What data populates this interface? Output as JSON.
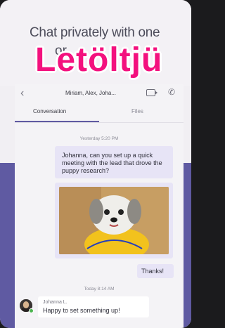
{
  "promo": {
    "line1": "Chat privately with one",
    "line2": "or",
    "overlay": "Letöltjü"
  },
  "header": {
    "title": "Miriam, Alex, Joha..."
  },
  "tabs": {
    "conversation": "Conversation",
    "files": "Files"
  },
  "messages": {
    "time1": "Yesterday 5:20 PM",
    "me_text": "Johanna, can you set up a quick meeting with the lead that drove the puppy research?",
    "photo_alt": "puppy photo",
    "thanks": "Thanks!",
    "time2": "Today 8:14 AM",
    "other_name": "Johanna L.",
    "other_text": "Happy to set something up!"
  },
  "colors": {
    "accent": "#5f5aa2",
    "overlay_pink": "#f3117e",
    "bubble_me": "#e7e4f6"
  },
  "icons": {
    "back": "back-chevron-icon",
    "video": "video-camera-icon",
    "call": "phone-icon"
  }
}
